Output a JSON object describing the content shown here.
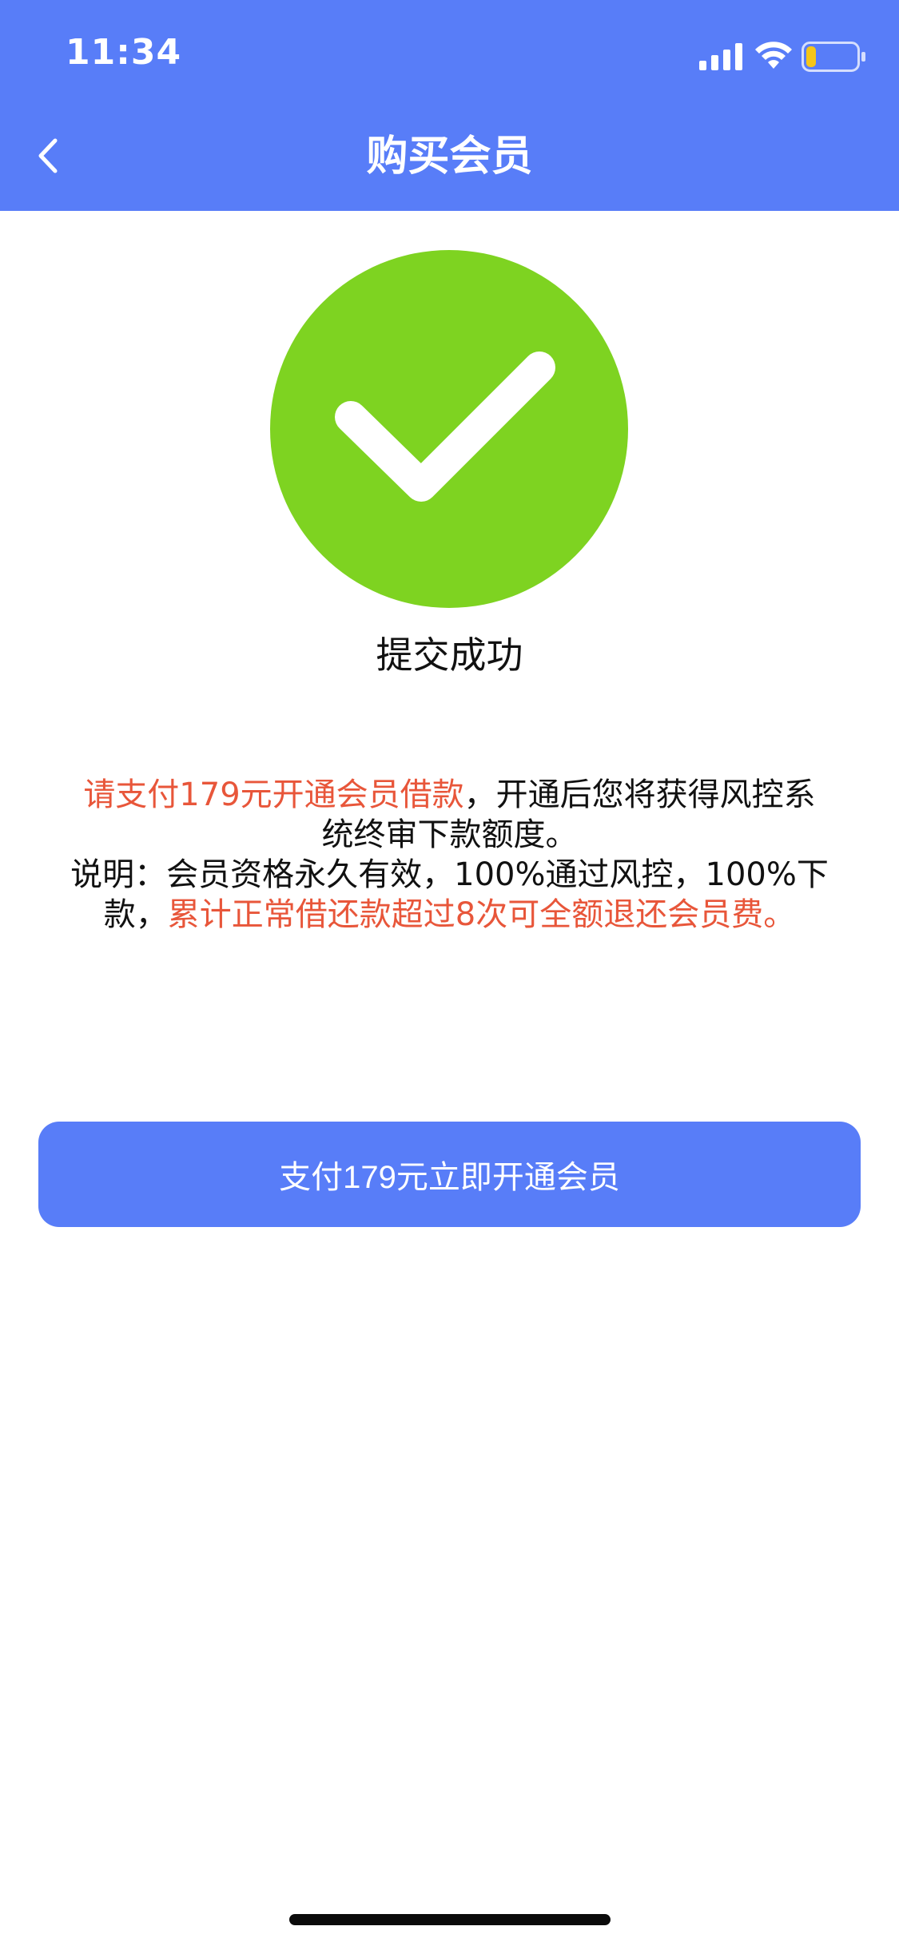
{
  "status_bar": {
    "time": "11:34",
    "icons": [
      "signal-icon",
      "wifi-icon",
      "battery-icon"
    ],
    "battery_level": 0.2,
    "battery_color": "#f5c518"
  },
  "nav": {
    "title": "购买会员",
    "back_icon": "chevron-left-icon"
  },
  "result": {
    "icon": "check-circle-icon",
    "icon_color": "#7ed321",
    "text": "提交成功"
  },
  "description": {
    "line1_red": "请支付179元开通会员借款",
    "line1_black": "，开通后您将获得风控系",
    "line2": "统终审下款额度。",
    "line3": "说明：会员资格永久有效，100%通过风控，100%下",
    "line4_black": "款，",
    "line4_red": "累计正常借还款超过8次可全额退还会员费。"
  },
  "action": {
    "pay_button_label": "支付179元立即开通会员"
  },
  "colors": {
    "primary": "#587df8",
    "highlight": "#e8563a",
    "success": "#7ed321"
  }
}
